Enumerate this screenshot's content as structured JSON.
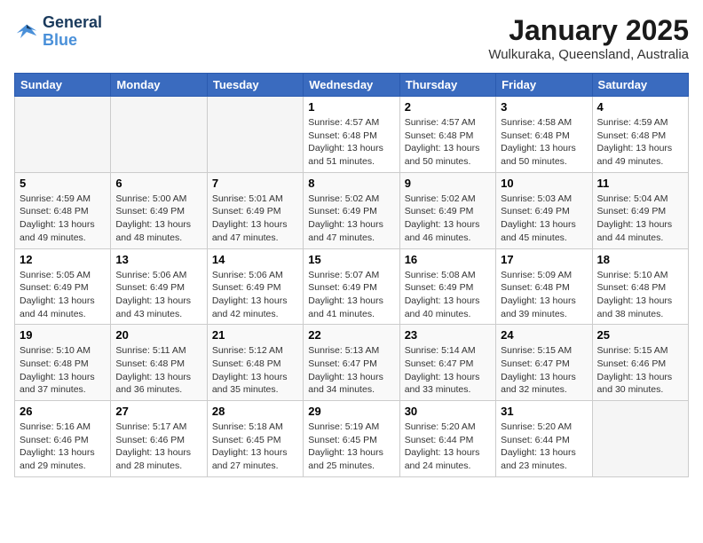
{
  "logo": {
    "line1": "General",
    "line2": "Blue"
  },
  "title": "January 2025",
  "location": "Wulkuraka, Queensland, Australia",
  "days_of_week": [
    "Sunday",
    "Monday",
    "Tuesday",
    "Wednesday",
    "Thursday",
    "Friday",
    "Saturday"
  ],
  "weeks": [
    [
      {
        "num": "",
        "info": ""
      },
      {
        "num": "",
        "info": ""
      },
      {
        "num": "",
        "info": ""
      },
      {
        "num": "1",
        "info": "Sunrise: 4:57 AM\nSunset: 6:48 PM\nDaylight: 13 hours\nand 51 minutes."
      },
      {
        "num": "2",
        "info": "Sunrise: 4:57 AM\nSunset: 6:48 PM\nDaylight: 13 hours\nand 50 minutes."
      },
      {
        "num": "3",
        "info": "Sunrise: 4:58 AM\nSunset: 6:48 PM\nDaylight: 13 hours\nand 50 minutes."
      },
      {
        "num": "4",
        "info": "Sunrise: 4:59 AM\nSunset: 6:48 PM\nDaylight: 13 hours\nand 49 minutes."
      }
    ],
    [
      {
        "num": "5",
        "info": "Sunrise: 4:59 AM\nSunset: 6:48 PM\nDaylight: 13 hours\nand 49 minutes."
      },
      {
        "num": "6",
        "info": "Sunrise: 5:00 AM\nSunset: 6:49 PM\nDaylight: 13 hours\nand 48 minutes."
      },
      {
        "num": "7",
        "info": "Sunrise: 5:01 AM\nSunset: 6:49 PM\nDaylight: 13 hours\nand 47 minutes."
      },
      {
        "num": "8",
        "info": "Sunrise: 5:02 AM\nSunset: 6:49 PM\nDaylight: 13 hours\nand 47 minutes."
      },
      {
        "num": "9",
        "info": "Sunrise: 5:02 AM\nSunset: 6:49 PM\nDaylight: 13 hours\nand 46 minutes."
      },
      {
        "num": "10",
        "info": "Sunrise: 5:03 AM\nSunset: 6:49 PM\nDaylight: 13 hours\nand 45 minutes."
      },
      {
        "num": "11",
        "info": "Sunrise: 5:04 AM\nSunset: 6:49 PM\nDaylight: 13 hours\nand 44 minutes."
      }
    ],
    [
      {
        "num": "12",
        "info": "Sunrise: 5:05 AM\nSunset: 6:49 PM\nDaylight: 13 hours\nand 44 minutes."
      },
      {
        "num": "13",
        "info": "Sunrise: 5:06 AM\nSunset: 6:49 PM\nDaylight: 13 hours\nand 43 minutes."
      },
      {
        "num": "14",
        "info": "Sunrise: 5:06 AM\nSunset: 6:49 PM\nDaylight: 13 hours\nand 42 minutes."
      },
      {
        "num": "15",
        "info": "Sunrise: 5:07 AM\nSunset: 6:49 PM\nDaylight: 13 hours\nand 41 minutes."
      },
      {
        "num": "16",
        "info": "Sunrise: 5:08 AM\nSunset: 6:49 PM\nDaylight: 13 hours\nand 40 minutes."
      },
      {
        "num": "17",
        "info": "Sunrise: 5:09 AM\nSunset: 6:48 PM\nDaylight: 13 hours\nand 39 minutes."
      },
      {
        "num": "18",
        "info": "Sunrise: 5:10 AM\nSunset: 6:48 PM\nDaylight: 13 hours\nand 38 minutes."
      }
    ],
    [
      {
        "num": "19",
        "info": "Sunrise: 5:10 AM\nSunset: 6:48 PM\nDaylight: 13 hours\nand 37 minutes."
      },
      {
        "num": "20",
        "info": "Sunrise: 5:11 AM\nSunset: 6:48 PM\nDaylight: 13 hours\nand 36 minutes."
      },
      {
        "num": "21",
        "info": "Sunrise: 5:12 AM\nSunset: 6:48 PM\nDaylight: 13 hours\nand 35 minutes."
      },
      {
        "num": "22",
        "info": "Sunrise: 5:13 AM\nSunset: 6:47 PM\nDaylight: 13 hours\nand 34 minutes."
      },
      {
        "num": "23",
        "info": "Sunrise: 5:14 AM\nSunset: 6:47 PM\nDaylight: 13 hours\nand 33 minutes."
      },
      {
        "num": "24",
        "info": "Sunrise: 5:15 AM\nSunset: 6:47 PM\nDaylight: 13 hours\nand 32 minutes."
      },
      {
        "num": "25",
        "info": "Sunrise: 5:15 AM\nSunset: 6:46 PM\nDaylight: 13 hours\nand 30 minutes."
      }
    ],
    [
      {
        "num": "26",
        "info": "Sunrise: 5:16 AM\nSunset: 6:46 PM\nDaylight: 13 hours\nand 29 minutes."
      },
      {
        "num": "27",
        "info": "Sunrise: 5:17 AM\nSunset: 6:46 PM\nDaylight: 13 hours\nand 28 minutes."
      },
      {
        "num": "28",
        "info": "Sunrise: 5:18 AM\nSunset: 6:45 PM\nDaylight: 13 hours\nand 27 minutes."
      },
      {
        "num": "29",
        "info": "Sunrise: 5:19 AM\nSunset: 6:45 PM\nDaylight: 13 hours\nand 25 minutes."
      },
      {
        "num": "30",
        "info": "Sunrise: 5:20 AM\nSunset: 6:44 PM\nDaylight: 13 hours\nand 24 minutes."
      },
      {
        "num": "31",
        "info": "Sunrise: 5:20 AM\nSunset: 6:44 PM\nDaylight: 13 hours\nand 23 minutes."
      },
      {
        "num": "",
        "info": ""
      }
    ]
  ]
}
